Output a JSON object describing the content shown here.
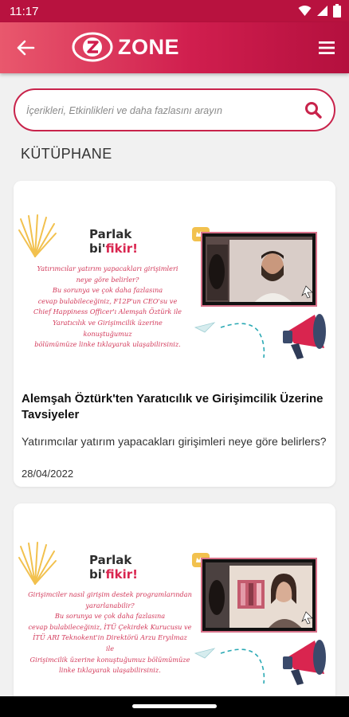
{
  "status_bar": {
    "time": "11:17"
  },
  "app_bar": {
    "logo_text": "ZONE"
  },
  "search": {
    "placeholder": "İçerikleri, Etkinlikleri ve daha fazlasını arayın"
  },
  "section": {
    "title": "KÜTÜPHANE"
  },
  "cards": [
    {
      "image": {
        "heading_line1": "Parlak",
        "heading_line2_prefix": "bi",
        "heading_line2_suffix": "fikir!",
        "caption_lines": [
          "Yatırımcılar yatırım yapacakları girişimleri",
          "neye göre belirler?",
          "Bu sorunya ve çok daha fazlasına",
          "cevap bulabileceğiniz, F12P'un CEO'su ve",
          "Chief Happiness Officer'ı Alemşah Öztürk ile",
          "Yaratıcılık ve Girişimcilik üzerine konuştuğumuz",
          "bölümümüze linke tıklayarak ulaşabilirsiniz."
        ]
      },
      "title": "Alemşah Öztürk'ten Yaratıcılık ve Girişimcilik Üzerine Tavsiyeler",
      "description": "Yatırımcılar yatırım yapacakları girişimleri neye göre belirlers?",
      "date": "28/04/2022"
    },
    {
      "image": {
        "heading_line1": "Parlak",
        "heading_line2_prefix": "bi",
        "heading_line2_suffix": "fikir!",
        "caption_lines": [
          "Girişimciler nasıl girişim destek programlarından",
          "yararlanabilir?",
          "Bu sorunya ve çok daha fazlasına",
          "cevap bulabileceğiniz, İTÜ Çekirdek Kurucusu ve",
          "İTÜ ARI Teknokent'in Direktörü Arzu Eryılmaz ile",
          "Girişimcilik üzerine konuştuğumuz bölümümüze",
          "linke tıklayarak ulaşabilirsiniz."
        ]
      }
    }
  ],
  "colors": {
    "brand": "#d01e4e",
    "accent": "#c8234b"
  }
}
